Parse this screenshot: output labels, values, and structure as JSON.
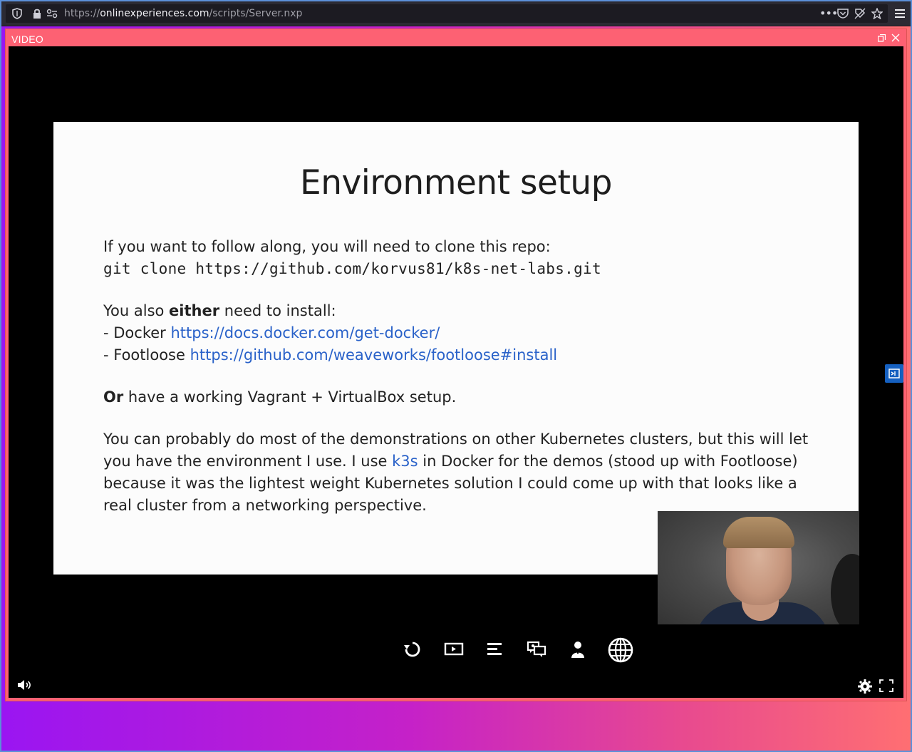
{
  "browser": {
    "url_scheme": "https://",
    "url_host": "onlinexperiences.com",
    "url_path": "/scripts/Server.nxp",
    "icons": [
      "shield-icon",
      "lock-icon",
      "permissions-icon",
      "more-icon",
      "pocket-icon",
      "tracker-icon",
      "bookmark-star-icon",
      "menu-icon"
    ]
  },
  "panel": {
    "label": "VIDEO",
    "header_bg": "#fd6173"
  },
  "slide": {
    "title": "Environment setup",
    "line1": "If you want to follow along, you will need to clone this repo:",
    "code": "git clone https://github.com/korvus81/k8s-net-labs.git",
    "install_pre": "You also ",
    "install_bold": "either",
    "install_post": " need to install:",
    "docker_label": "- Docker ",
    "docker_link": "https://docs.docker.com/get-docker/",
    "footloose_label": "- Footloose ",
    "footloose_link": "https://github.com/weaveworks/footloose#install",
    "or_bold": "Or",
    "or_rest": " have a working Vagrant + VirtualBox setup.",
    "para_a": "You can probably do most of the demonstrations on other Kubernetes clusters, but this will let you have the environment I use. I use ",
    "para_link": "k3s",
    "para_b": " in Docker for the demos (stood up with Footloose) because it was the lightest weight Kubernetes solution I could come up with that looks like a real cluster from a networking perspective.",
    "link_color": "#2a62c9"
  },
  "controls": {
    "buttons": [
      "replay-icon",
      "slides-icon",
      "agenda-icon",
      "chat-icon",
      "presenter-icon",
      "language-globe-icon"
    ],
    "bottom_left": "volume-icon",
    "bottom_right": [
      "settings-gear-icon",
      "fullscreen-icon"
    ]
  }
}
